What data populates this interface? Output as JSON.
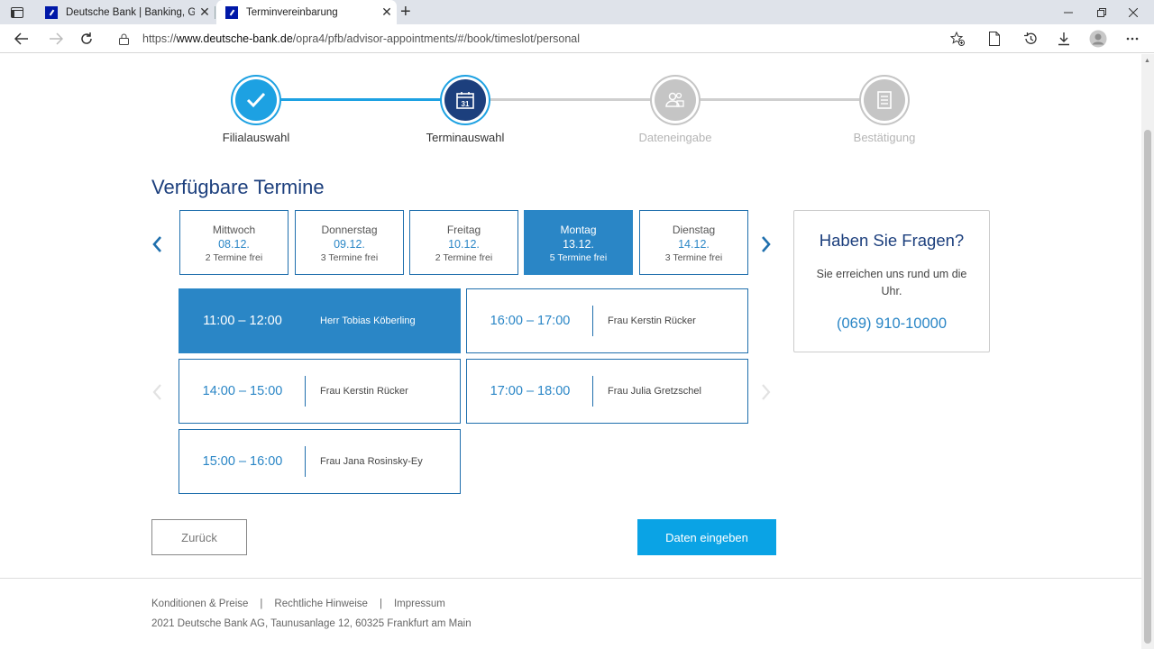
{
  "browser": {
    "tabs": [
      {
        "title": "Deutsche Bank | Banking, Geldan",
        "active": false
      },
      {
        "title": "Terminvereinbarung",
        "active": true
      }
    ],
    "url_prefix": "https://",
    "url_host": "www.deutsche-bank.de",
    "url_path": "/opra4/pfb/advisor-appointments/#/book/timeslot/personal"
  },
  "stepper": {
    "steps": [
      {
        "label": "Filialauswahl",
        "state": "done",
        "icon": "check-icon"
      },
      {
        "label": "Terminauswahl",
        "state": "active",
        "icon": "calendar-icon"
      },
      {
        "label": "Dateneingabe",
        "state": "pending",
        "icon": "people-icon"
      },
      {
        "label": "Bestätigung",
        "state": "pending",
        "icon": "document-icon"
      }
    ]
  },
  "main": {
    "title": "Verfügbare Termine",
    "days": [
      {
        "name": "Mittwoch",
        "date": "08.12.",
        "free": "2 Termine frei",
        "selected": false
      },
      {
        "name": "Donnerstag",
        "date": "09.12.",
        "free": "3 Termine frei",
        "selected": false
      },
      {
        "name": "Freitag",
        "date": "10.12.",
        "free": "2 Termine frei",
        "selected": false
      },
      {
        "name": "Montag",
        "date": "13.12.",
        "free": "5 Termine frei",
        "selected": true
      },
      {
        "name": "Dienstag",
        "date": "14.12.",
        "free": "3 Termine frei",
        "selected": false
      }
    ],
    "slots": [
      {
        "time": "11:00 – 12:00",
        "person": "Herr Tobias Köberling",
        "selected": true
      },
      {
        "time": "16:00 – 17:00",
        "person": "Frau Kerstin Rücker",
        "selected": false
      },
      {
        "time": "14:00 – 15:00",
        "person": "Frau Kerstin Rücker",
        "selected": false
      },
      {
        "time": "17:00 – 18:00",
        "person": "Frau Julia Gretzschel",
        "selected": false
      },
      {
        "time": "15:00 – 16:00",
        "person": "Frau Jana Rosinsky-Ey",
        "selected": false
      }
    ]
  },
  "faq": {
    "title": "Haben Sie Fragen?",
    "text": "Sie erreichen uns rund um die Uhr.",
    "phone": "(069) 910-10000"
  },
  "buttons": {
    "back": "Zurück",
    "next": "Daten eingeben"
  },
  "footer": {
    "links": [
      "Konditionen & Preise",
      "Rechtliche Hinweise",
      "Impressum"
    ],
    "separator": "|",
    "copyright": "2021 Deutsche Bank AG, Taunusanlage 12, 60325 Frankfurt am Main"
  },
  "colors": {
    "accent": "#2a86c6",
    "primary_button": "#0aa3e5",
    "heading": "#1c3f7d",
    "done_step": "#1da1e2",
    "active_step": "#1c3f7d",
    "pending_step": "#c5c5c5"
  }
}
